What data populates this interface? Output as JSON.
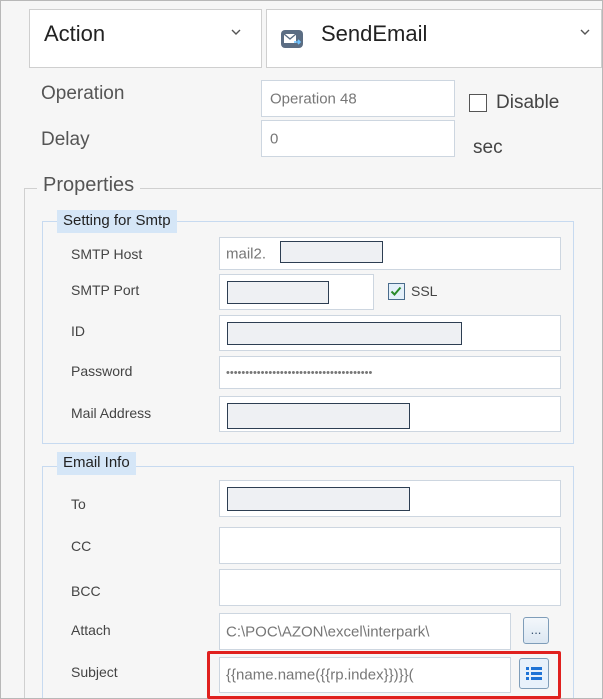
{
  "header": {
    "action_label": "Action",
    "command_value": "SendEmail",
    "command_icon": "send-email-icon"
  },
  "operation": {
    "label": "Operation",
    "value": "Operation 48",
    "disable_label": "Disable",
    "disable_checked": false
  },
  "delay": {
    "label": "Delay",
    "value": "0",
    "unit": "sec"
  },
  "properties": {
    "title": "Properties",
    "smtp": {
      "title": "Setting for Smtp",
      "host_label": "SMTP Host",
      "host_value": "mail2.",
      "port_label": "SMTP Port",
      "ssl_label": "SSL",
      "ssl_checked": true,
      "id_label": "ID",
      "password_label": "Password",
      "password_value": "••••••••••••••••••••••••••••••••••••••",
      "mail_label": "Mail Address"
    },
    "email": {
      "title": "Email Info",
      "to_label": "To",
      "cc_label": "CC",
      "bcc_label": "BCC",
      "attach_label": "Attach",
      "attach_value": "C:\\POC\\AZON\\excel\\interpark\\",
      "attach_button": "...",
      "subject_label": "Subject",
      "subject_value": "{{name.name({{rp.index}})}}(",
      "subject_icon": "list-icon"
    }
  },
  "colors": {
    "highlight": "#e0201e",
    "accent": "#1f73d6"
  }
}
